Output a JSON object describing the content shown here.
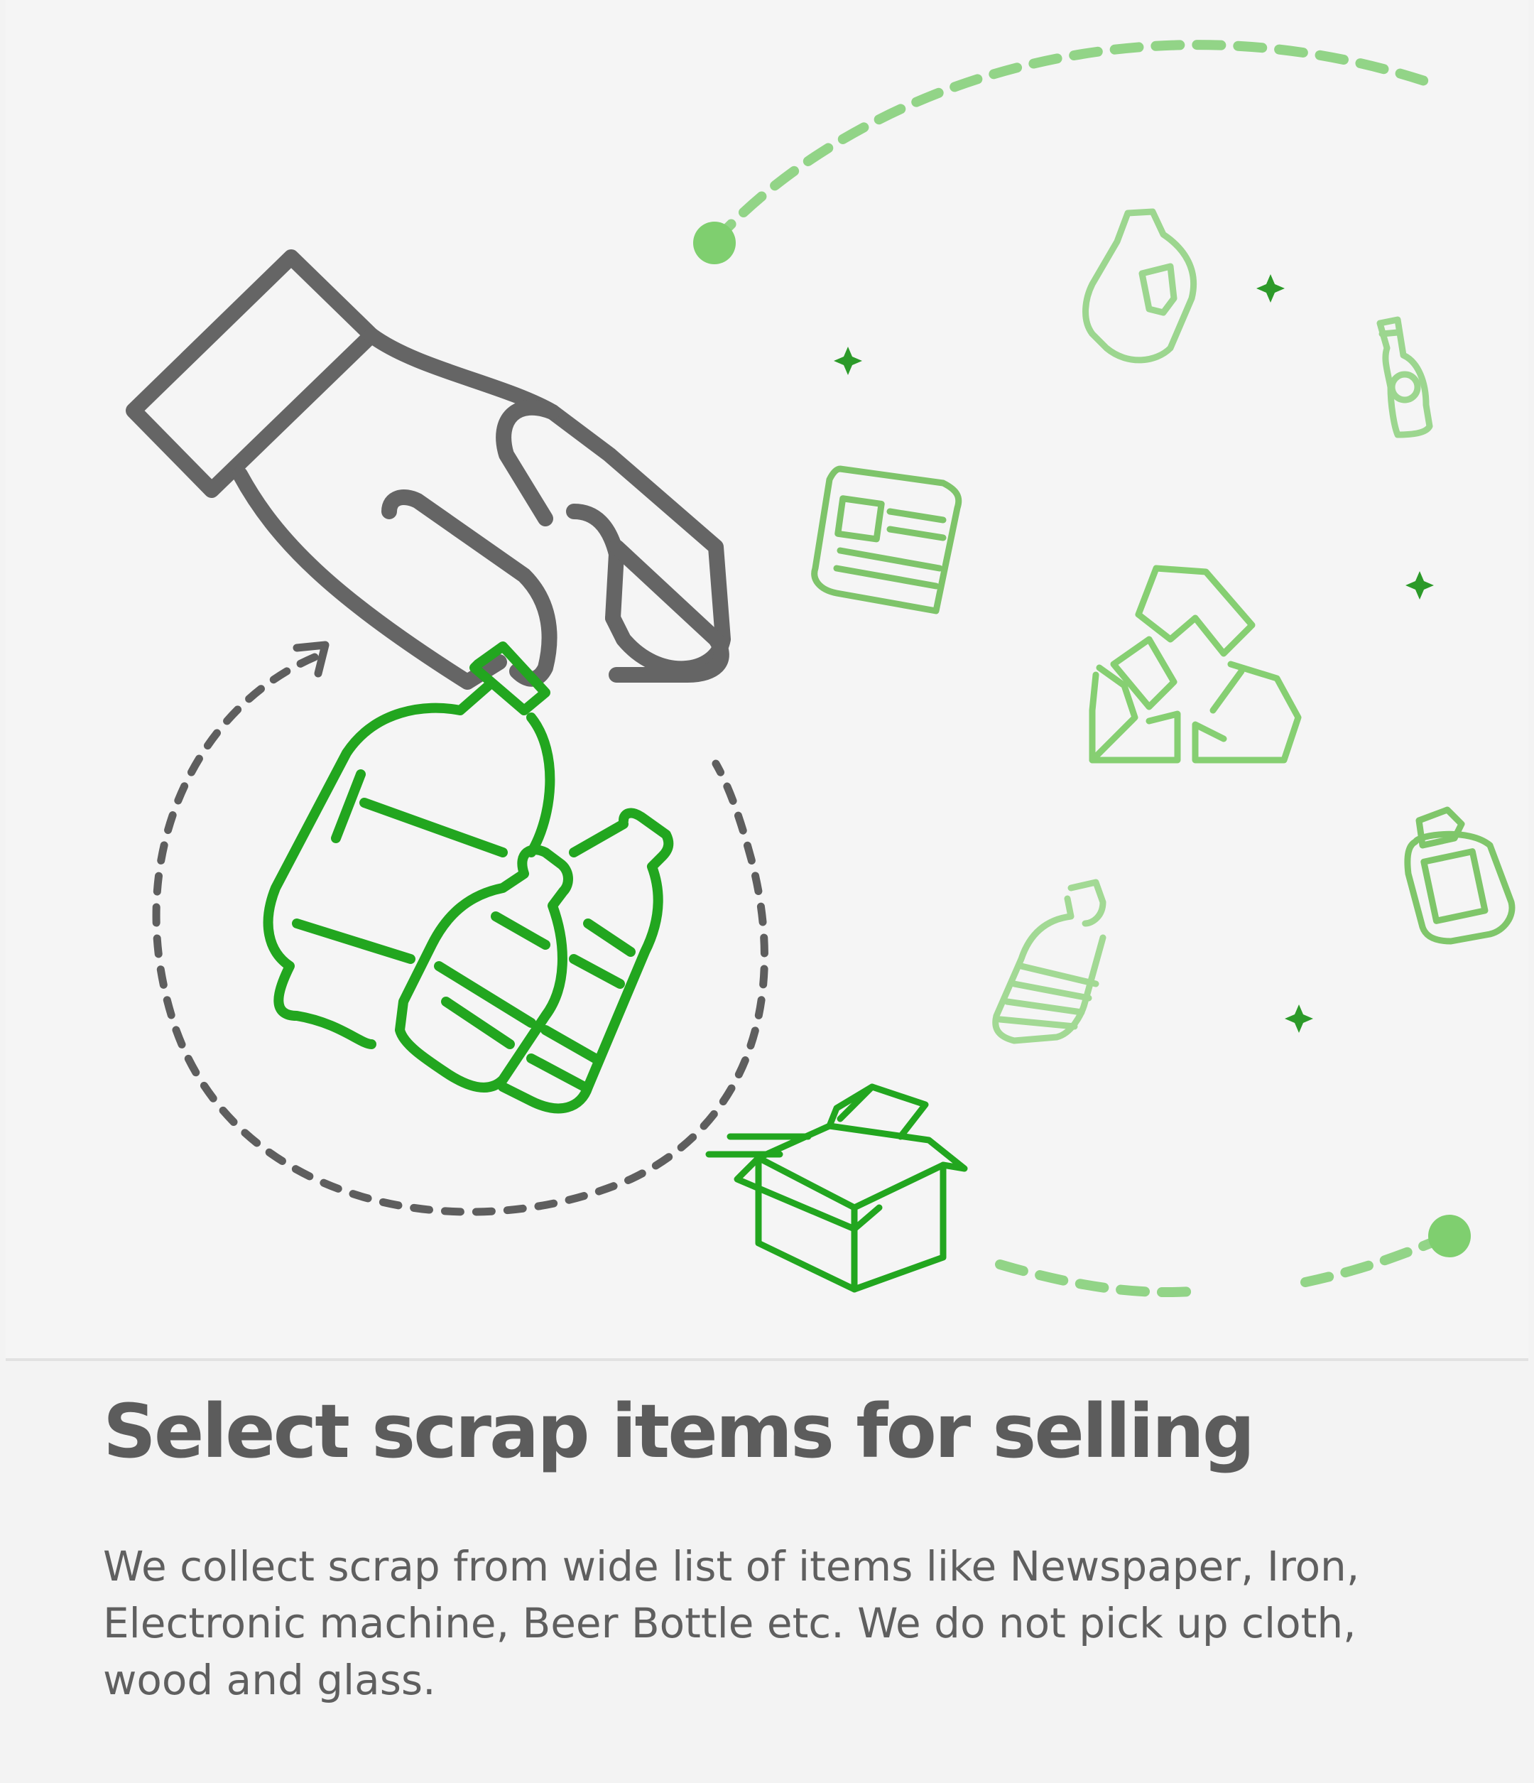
{
  "onboarding": {
    "title": "Select scrap items for selling",
    "description": "We collect scrap from wide list of items like Newspaper, Iron, Electronic machine, Beer Bottle etc. We do not pick up cloth, wood and glass."
  },
  "colors": {
    "background": "#f3f3f3",
    "accent_green": "#22a61f",
    "light_green": "#8fd27f",
    "hand_gray": "#656565",
    "title_text": "#5c5c5c",
    "body_text": "#5f5f5f"
  },
  "icons": [
    "hand-icon",
    "plastic-bottles-icon",
    "cardboard-box-icon",
    "newspaper-icon",
    "recycle-icon",
    "jug-icon",
    "beer-bottle-icon",
    "water-bottle-icon",
    "jar-icon",
    "sparkle-icon"
  ]
}
